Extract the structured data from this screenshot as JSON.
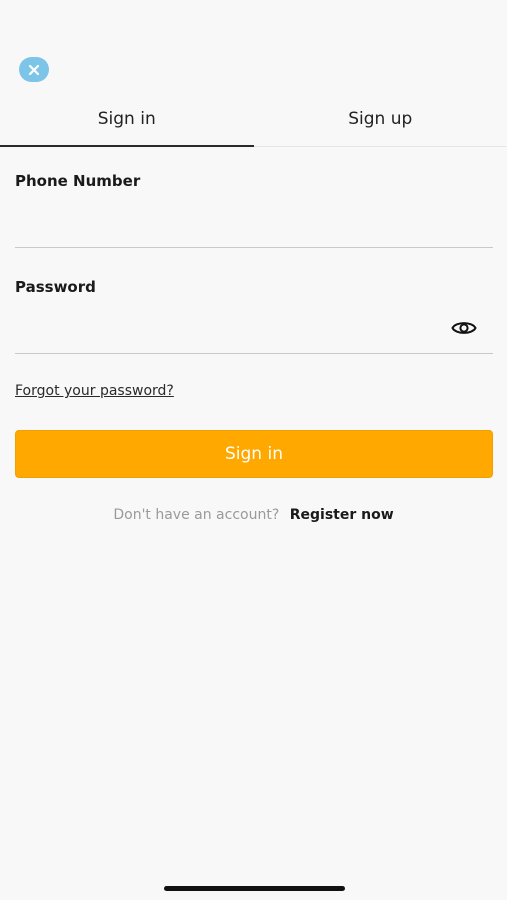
{
  "tabs": [
    {
      "label": "Sign in",
      "active": true
    },
    {
      "label": "Sign up",
      "active": false
    }
  ],
  "form": {
    "phone_label": "Phone Number",
    "phone_value": "",
    "password_label": "Password",
    "password_value": "",
    "forgot_link": "Forgot your password?",
    "submit_label": "Sign in"
  },
  "register": {
    "prompt": "Don't have an account?",
    "link": "Register now"
  },
  "icons": {
    "close": "close-icon",
    "password_toggle": "eye-icon"
  },
  "colors": {
    "primary": "#ffa800",
    "close_button": "#7dc5e8",
    "background": "#f8f8f8",
    "muted_text": "#9a9a9a"
  }
}
